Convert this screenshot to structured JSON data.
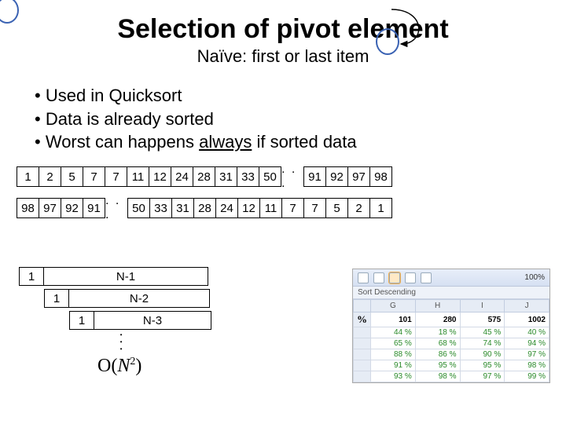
{
  "title": "Selection of pivot element",
  "subtitle": "Naïve: first or last item",
  "bullets": [
    "Used in Quicksort",
    "Data is already sorted",
    "Worst can happens always if sorted data"
  ],
  "always_word": "always",
  "array1_left": [
    "1",
    "2",
    "5",
    "7",
    "7",
    "11",
    "12",
    "24",
    "28",
    "31",
    "33",
    "50"
  ],
  "array1_right": [
    "91",
    "92",
    "97",
    "98"
  ],
  "array2_left": [
    "98",
    "97",
    "92",
    "91"
  ],
  "array2_right": [
    "50",
    "33",
    "31",
    "28",
    "24",
    "12",
    "11",
    "7",
    "7",
    "5",
    "2",
    "1"
  ],
  "ellipsis": ". . .",
  "steps": {
    "one": "1",
    "labels": [
      "N-1",
      "N-2",
      "N-3"
    ],
    "widths": [
      210,
      180,
      150
    ]
  },
  "vdots": ". . .",
  "bigO": "O(N²)",
  "shot": {
    "zoom": "100%",
    "sort_label": "Sort Descending",
    "pct_symbol": "%",
    "cols": [
      "G",
      "H",
      "I",
      "J"
    ],
    "rows": [
      [
        "",
        "101",
        "280",
        "575",
        "1002"
      ],
      [
        "",
        "44 %",
        "18 %",
        "45 %",
        "40 %"
      ],
      [
        "",
        "65 %",
        "68 %",
        "74 %",
        "94 %"
      ],
      [
        "",
        "88 %",
        "86 %",
        "90 %",
        "97 %"
      ],
      [
        "",
        "91 %",
        "95 %",
        "95 %",
        "98 %"
      ],
      [
        "",
        "93 %",
        "98 %",
        "97 %",
        "99 %"
      ]
    ]
  }
}
